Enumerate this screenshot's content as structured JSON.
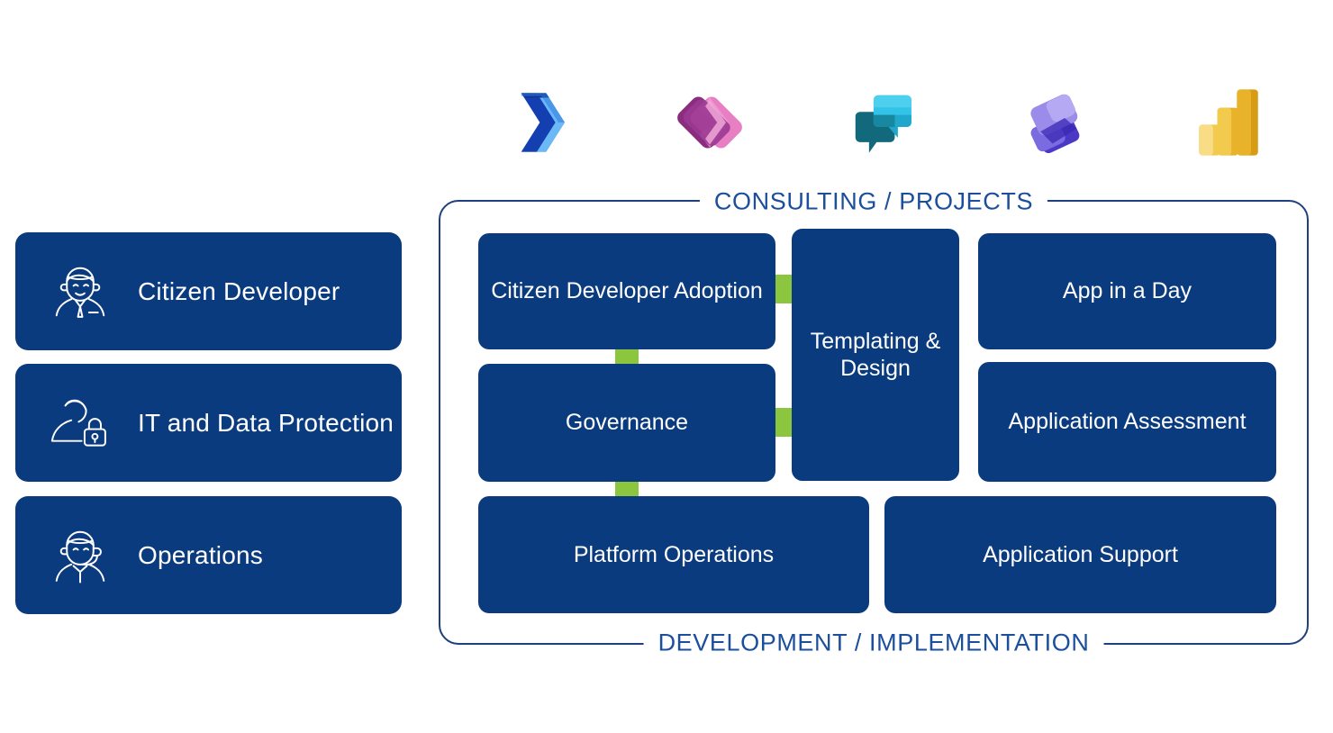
{
  "colors": {
    "box_blue": "#0B3B7F",
    "frame_blue": "#1F3F7F",
    "label_blue": "#1B4E9B",
    "connector_green": "#8CC63F",
    "background": "#FFFFFF"
  },
  "logos": [
    {
      "name": "power-automate-logo",
      "label": "Power Automate"
    },
    {
      "name": "power-apps-logo",
      "label": "Power Apps"
    },
    {
      "name": "power-virtual-agents-logo",
      "label": "Power Virtual Agents"
    },
    {
      "name": "power-pages-logo",
      "label": "Power Pages"
    },
    {
      "name": "power-bi-logo",
      "label": "Power BI"
    }
  ],
  "roles": [
    {
      "label": "Citizen Developer",
      "icon": "person-tie-icon"
    },
    {
      "label": "IT and Data Protection",
      "icon": "person-lock-icon"
    },
    {
      "label": "Operations",
      "icon": "person-headset-icon"
    }
  ],
  "frame": {
    "top_label": "CONSULTING / PROJECTS",
    "bottom_label": "DEVELOPMENT / IMPLEMENTATION"
  },
  "services": {
    "citizen_developer_adoption": "Citizen Developer Adoption",
    "governance": "Governance",
    "templating_design": "Templating & Design",
    "app_in_a_day": "App in a Day",
    "application_assessment": "Application Assessment",
    "platform_operations": "Platform Operations",
    "application_support": "Application Support"
  }
}
